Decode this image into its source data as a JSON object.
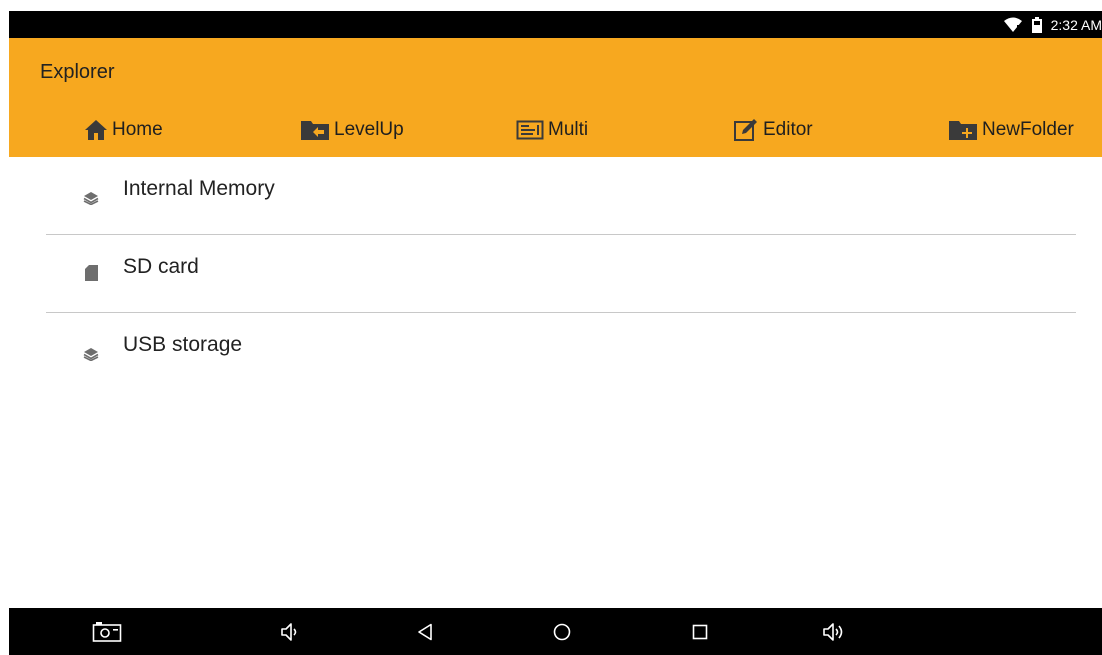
{
  "status_bar": {
    "time": "2:32 AM",
    "icons": [
      "wifi-icon",
      "battery-icon"
    ]
  },
  "app": {
    "title": "Explorer"
  },
  "toolbar": {
    "home_label": "Home",
    "levelup_label": "LevelUp",
    "multi_label": "Multi",
    "editor_label": "Editor",
    "newfolder_label": "NewFolder"
  },
  "storage_list": {
    "items": [
      {
        "label": "Internal Memory",
        "icon": "layers-icon"
      },
      {
        "label": "SD card",
        "icon": "sd-card-icon"
      },
      {
        "label": "USB storage",
        "icon": "layers-icon"
      }
    ]
  },
  "nav_bar": {
    "icons": [
      "screenshot-icon",
      "volume-down-icon",
      "back-icon",
      "home-circle-icon",
      "recents-icon",
      "volume-up-icon"
    ]
  },
  "colors": {
    "accent": "#F7A81F",
    "status_bar": "#000000",
    "nav_bar": "#000000",
    "divider": "#C8C8C8"
  }
}
